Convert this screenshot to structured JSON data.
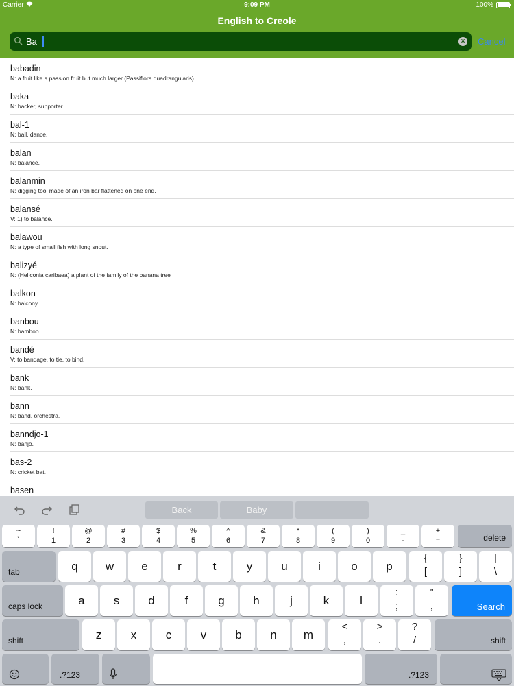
{
  "status": {
    "carrier": "Carrier",
    "time": "9:09 PM",
    "battery": "100%"
  },
  "nav": {
    "title": "English to Creole"
  },
  "search": {
    "query": "Ba",
    "cancel_label": "Cancel"
  },
  "results": [
    {
      "word": "babadin",
      "def": "N:  a fruit like a passion fruit but much larger (Passiflora quadrangularis)."
    },
    {
      "word": "baka",
      "def": "N:  backer, supporter."
    },
    {
      "word": "bal-1",
      "def": "N:  ball, dance."
    },
    {
      "word": "balan",
      "def": "N:  balance."
    },
    {
      "word": "balanmin",
      "def": "N:  digging tool made of an iron bar flattened on one end."
    },
    {
      "word": "balansé",
      "def": "V:  1) to balance."
    },
    {
      "word": "balawou",
      "def": "N:  a type of small fish with long snout."
    },
    {
      "word": "balizyé",
      "def": "N:  (Heliconia caribaea) a plant of the family of the banana tree"
    },
    {
      "word": "balkon",
      "def": "N:  balcony."
    },
    {
      "word": "banbou",
      "def": "N:  bamboo."
    },
    {
      "word": "bandé",
      "def": "V:  to bandage, to tie, to bind."
    },
    {
      "word": "bank",
      "def": "N:  bank."
    },
    {
      "word": "bann",
      "def": "N:  band, orchestra."
    },
    {
      "word": "banndjo-1",
      "def": "N:  banjo."
    },
    {
      "word": "bas-2",
      "def": "N:  cricket bat."
    },
    {
      "word": "basen",
      "def": ""
    }
  ],
  "keyboard": {
    "suggestions": [
      "Back",
      "Baby",
      ""
    ],
    "number_row": [
      {
        "top": "~",
        "bot": "`"
      },
      {
        "top": "!",
        "bot": "1"
      },
      {
        "top": "@",
        "bot": "2"
      },
      {
        "top": "#",
        "bot": "3"
      },
      {
        "top": "$",
        "bot": "4"
      },
      {
        "top": "%",
        "bot": "5"
      },
      {
        "top": "^",
        "bot": "6"
      },
      {
        "top": "&",
        "bot": "7"
      },
      {
        "top": "*",
        "bot": "8"
      },
      {
        "top": "(",
        "bot": "9"
      },
      {
        "top": ")",
        "bot": "0"
      },
      {
        "top": "_",
        "bot": "-"
      },
      {
        "top": "+",
        "bot": "="
      }
    ],
    "delete_label": "delete",
    "tab_label": "tab",
    "row_q": [
      "q",
      "w",
      "e",
      "r",
      "t",
      "y",
      "u",
      "i",
      "o",
      "p"
    ],
    "row_q_extra": [
      {
        "top": "{",
        "bot": "["
      },
      {
        "top": "}",
        "bot": "]"
      },
      {
        "top": "|",
        "bot": "\\"
      }
    ],
    "caps_label": "caps lock",
    "row_a": [
      "a",
      "s",
      "d",
      "f",
      "g",
      "h",
      "j",
      "k",
      "l"
    ],
    "row_a_extra": [
      {
        "top": ":",
        "bot": ";"
      },
      {
        "top": "”",
        "bot": ","
      }
    ],
    "search_label": "Search",
    "shift_label": "shift",
    "row_z": [
      "z",
      "x",
      "c",
      "v",
      "b",
      "n",
      "m"
    ],
    "row_z_extra": [
      {
        "top": "<",
        "bot": ","
      },
      {
        "top": ">",
        "bot": "."
      },
      {
        "top": "?",
        "bot": "/"
      }
    ],
    "numbers_label": ".?123",
    "icons": [
      "undo-icon",
      "redo-icon",
      "clipboard-icon",
      "emoji-icon",
      "microphone-icon",
      "keyboard-dismiss-icon",
      "search-icon",
      "clear-icon",
      "wifi-icon",
      "battery-icon"
    ]
  }
}
